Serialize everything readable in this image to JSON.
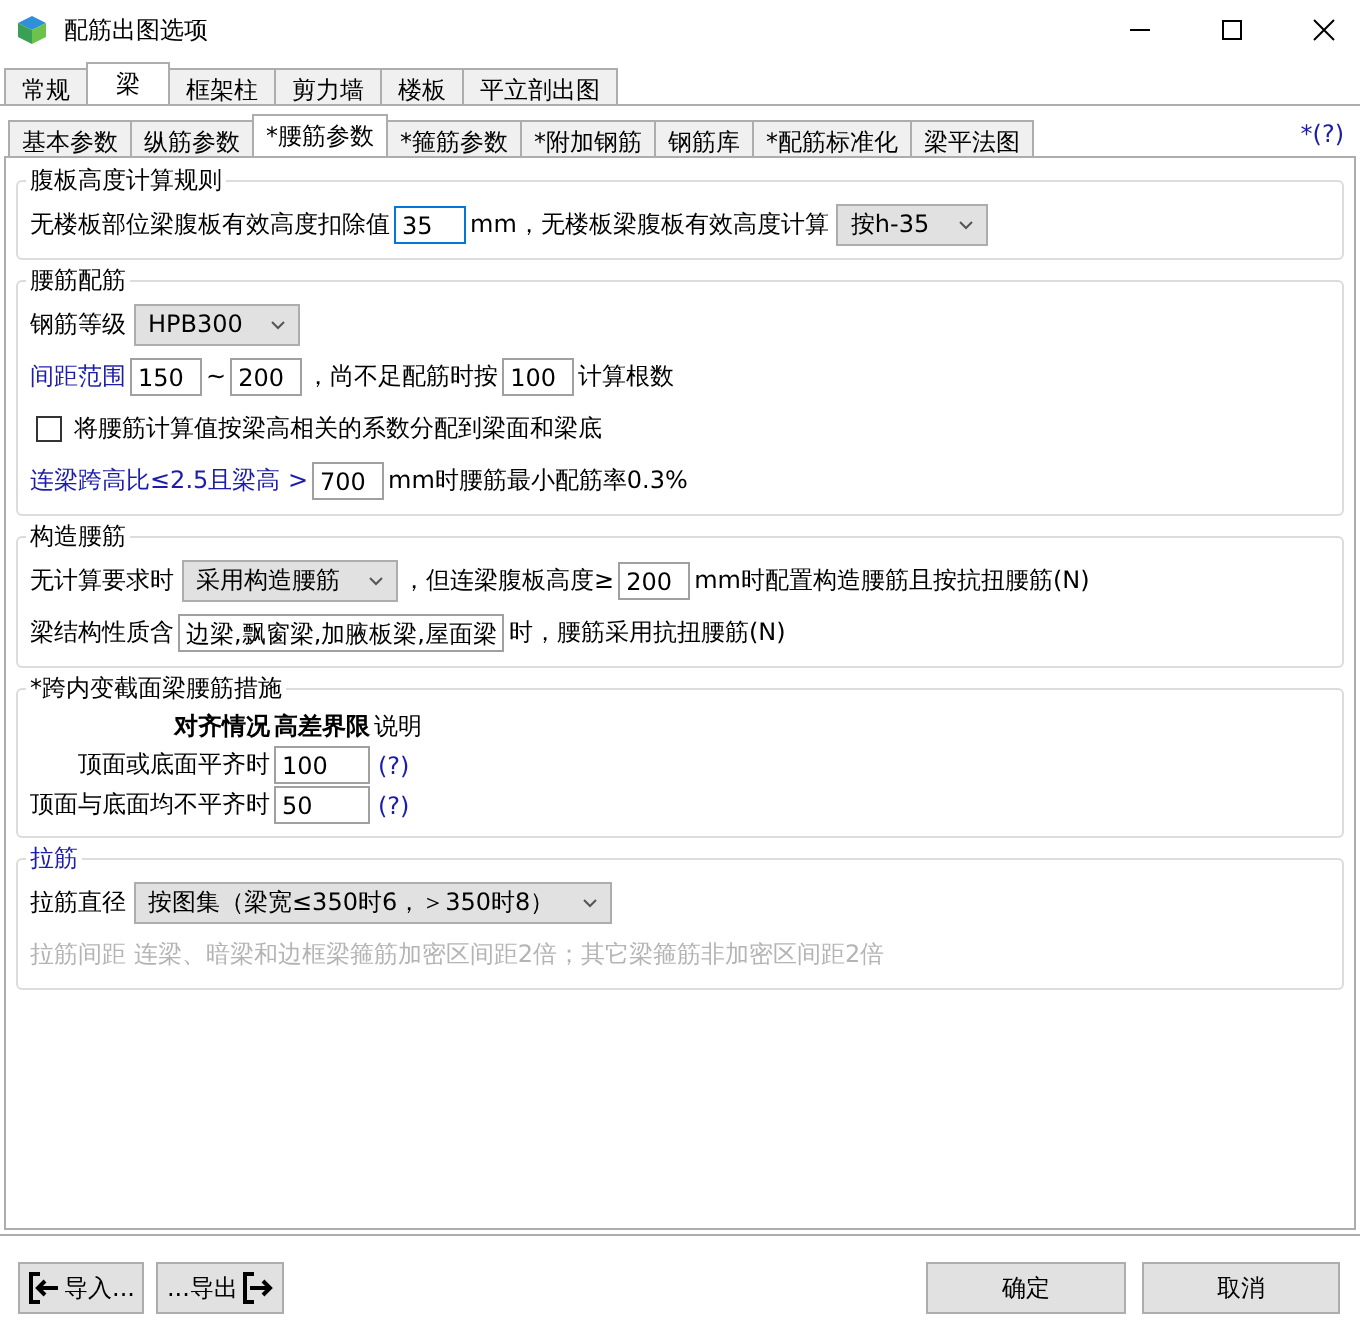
{
  "window": {
    "title": "配筋出图选项"
  },
  "main_tabs": [
    {
      "label": "常规",
      "selected": false
    },
    {
      "label": "梁",
      "selected": true
    },
    {
      "label": "框架柱",
      "selected": false
    },
    {
      "label": "剪力墙",
      "selected": false
    },
    {
      "label": "楼板",
      "selected": false
    },
    {
      "label": "平立剖出图",
      "selected": false
    }
  ],
  "sub_tabs": [
    {
      "label": "基本参数",
      "selected": false
    },
    {
      "label": "纵筋参数",
      "selected": false
    },
    {
      "label": "*腰筋参数",
      "selected": true
    },
    {
      "label": "*箍筋参数",
      "selected": false
    },
    {
      "label": "*附加钢筋",
      "selected": false
    },
    {
      "label": "钢筋库",
      "selected": false
    },
    {
      "label": "*配筋标准化",
      "selected": false
    },
    {
      "label": "梁平法图",
      "selected": false
    }
  ],
  "help_link": "*(?)",
  "groups": [
    {
      "title": "腹板高度计算规则",
      "title_highlighted": false,
      "lines": [
        {
          "parts": [
            {
              "kind": "text",
              "text": "无楼板部位梁腹板有效高度扣除值"
            },
            {
              "kind": "input",
              "value": "35",
              "focused": true
            },
            {
              "kind": "text",
              "text": "mm，无楼板梁腹板有效高度计算"
            },
            {
              "kind": "select",
              "value": "按h-35"
            }
          ]
        }
      ]
    },
    {
      "title": "腰筋配筋",
      "title_highlighted": false,
      "lines": [
        {
          "parts": [
            {
              "kind": "text",
              "text": "钢筋等级"
            },
            {
              "kind": "select",
              "value": "HPB300"
            }
          ]
        },
        {
          "parts": [
            {
              "kind": "note",
              "text": "间距范围"
            },
            {
              "kind": "input",
              "value": "150",
              "focused": false
            },
            {
              "kind": "text",
              "text": "~"
            },
            {
              "kind": "input",
              "value": "200",
              "focused": false
            },
            {
              "kind": "text",
              "text": "，尚不足配筋时按"
            },
            {
              "kind": "input",
              "value": "100",
              "focused": false
            },
            {
              "kind": "text",
              "text": "计算根数"
            }
          ]
        },
        {
          "parts": [
            {
              "kind": "checkbox",
              "text": "将腰筋计算值按梁高相关的系数分配到梁面和梁底",
              "checked": false
            }
          ]
        },
        {
          "parts": [
            {
              "kind": "note",
              "text": "连梁跨高比≤2.5且梁高 >"
            },
            {
              "kind": "input",
              "value": "700",
              "focused": false
            },
            {
              "kind": "text",
              "text": "mm时腰筋最小配筋率0.3%"
            }
          ]
        }
      ]
    },
    {
      "title": "构造腰筋",
      "title_highlighted": false,
      "lines": [
        {
          "parts": [
            {
              "kind": "text",
              "text": "无计算要求时"
            },
            {
              "kind": "select",
              "value": "采用构造腰筋"
            },
            {
              "kind": "text",
              "text": "，但连梁腹板高度≥"
            },
            {
              "kind": "input",
              "value": "200",
              "focused": false
            },
            {
              "kind": "text",
              "text": "mm时配置构造腰筋且按抗扭腰筋(N)"
            }
          ]
        },
        {
          "parts": [
            {
              "kind": "text",
              "text": "梁结构性质含"
            },
            {
              "kind": "input",
              "value": "边梁,飘窗梁,加腋板梁,屋面梁",
              "focused": false
            },
            {
              "kind": "text",
              "text": "时，腰筋采用抗扭腰筋(N)"
            }
          ]
        }
      ]
    },
    {
      "title": "*跨内变截面梁腰筋措施",
      "title_highlighted": false,
      "table": {
        "columns": [
          {
            "label": "对齐情况",
            "bold": true
          },
          {
            "label": "高差界限",
            "bold": true
          },
          {
            "label": "说明",
            "bold": false
          }
        ],
        "rows": [
          {
            "label": "顶面或底面平齐时",
            "value": "100",
            "link": "(?)"
          },
          {
            "label": "顶面与底面均不平齐时",
            "value": "50",
            "link": "(?)"
          }
        ]
      }
    },
    {
      "title": "拉筋",
      "title_highlighted": true,
      "lines": [
        {
          "parts": [
            {
              "kind": "text",
              "text": "拉筋直径"
            },
            {
              "kind": "select",
              "value": "按图集（梁宽≤350时6，＞350时8）"
            }
          ]
        },
        {
          "parts": [
            {
              "kind": "disabled",
              "text": "拉筋间距 连梁、暗梁和边框梁箍筋加密区间距2倍；其它梁箍筋非加密区间距2倍"
            }
          ]
        }
      ]
    }
  ],
  "buttons": [
    {
      "label": "导入...",
      "kind": "import"
    },
    {
      "label": "...导出",
      "kind": "export"
    },
    {
      "label": "确定",
      "kind": "plain"
    },
    {
      "label": "取消",
      "kind": "plain"
    }
  ]
}
